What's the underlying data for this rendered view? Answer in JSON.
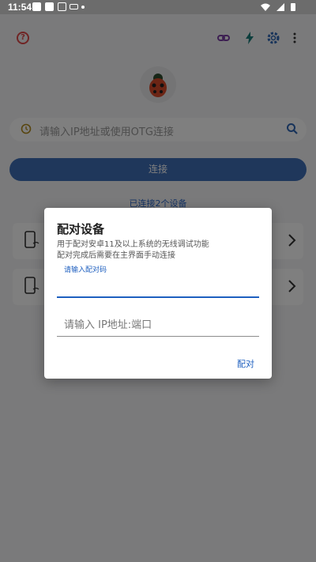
{
  "status_bar": {
    "time": "11:54"
  },
  "app": {
    "search_placeholder": "请输入IP地址或使用OTG连接",
    "connect_label": "连接",
    "connected_text": "已连接2个设备",
    "icons": [
      "help-icon",
      "link-icon",
      "flash-icon",
      "settings-icon",
      "more-vert-icon",
      "ladybug-logo",
      "history-icon",
      "search-icon",
      "phone-wifi-icon",
      "chevron-right-icon"
    ],
    "colors": {
      "primary": "#3f6fb7",
      "accent": "#1e5fbf",
      "help": "#e14848"
    }
  },
  "dialog": {
    "title": "配对设备",
    "description_line1": "用于配对安卓11及以上系统的无线调试功能",
    "description_line2": "配对完成后需要在主界面手动连接",
    "code_label": "请输入配对码",
    "code_value": "",
    "ip_placeholder": "请输入 IP地址:端口",
    "ip_value": "",
    "pair_label": "配对"
  }
}
